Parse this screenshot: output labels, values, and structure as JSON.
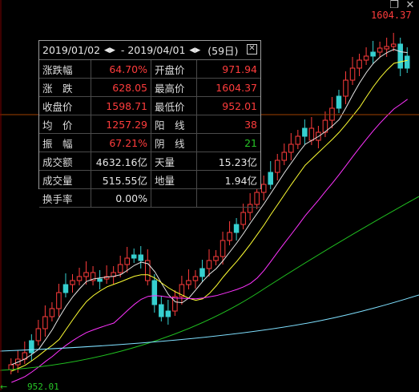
{
  "chart": {
    "high_label": "1604.37",
    "low_label": "952.01",
    "colors": {
      "up": "#ff3c3c",
      "down": "#36d0d0",
      "ma5": "#e6e6e6",
      "ma10": "#ffff33",
      "ma20": "#ff33ff",
      "ma60": "#20c020",
      "ma120": "#7fe0ff",
      "ref_line": "#a04000",
      "grid": "#3a0000"
    }
  },
  "window": {
    "restore_icon": "restore-icon",
    "close_icon": "close-icon"
  },
  "stats": {
    "start_date": "2019/01/02",
    "end_date": "2019/04/01",
    "period": "(59日)",
    "rows": [
      {
        "k1": "涨跌幅",
        "v1": "64.70%",
        "c1": "red",
        "k2": "开盘价",
        "v2": "971.94",
        "c2": "red"
      },
      {
        "k1": "涨　跌",
        "v1": "628.05",
        "c1": "red",
        "k2": "最高价",
        "v2": "1604.37",
        "c2": "red"
      },
      {
        "k1": "收盘价",
        "v1": "1598.71",
        "c1": "red",
        "k2": "最低价",
        "v2": "952.01",
        "c2": "red"
      },
      {
        "k1": "均　价",
        "v1": "1257.29",
        "c1": "red",
        "k2": "阳　线",
        "v2": "38",
        "c2": "red"
      },
      {
        "k1": "振　幅",
        "v1": "67.21%",
        "c1": "red",
        "k2": "阴　线",
        "v2": "21",
        "c2": "grn"
      },
      {
        "k1": "成交额",
        "v1": "4632.16亿",
        "c1": "wht",
        "k2": "天量",
        "v2": "15.23亿",
        "c2": "wht"
      },
      {
        "k1": "成交量",
        "v1": "515.55亿",
        "c1": "wht",
        "k2": "地量",
        "v2": "1.94亿",
        "c2": "wht"
      },
      {
        "k1": "换手率",
        "v1": "0.00%",
        "c1": "wht",
        "k2": "",
        "v2": "",
        "c2": "wht"
      }
    ]
  }
}
